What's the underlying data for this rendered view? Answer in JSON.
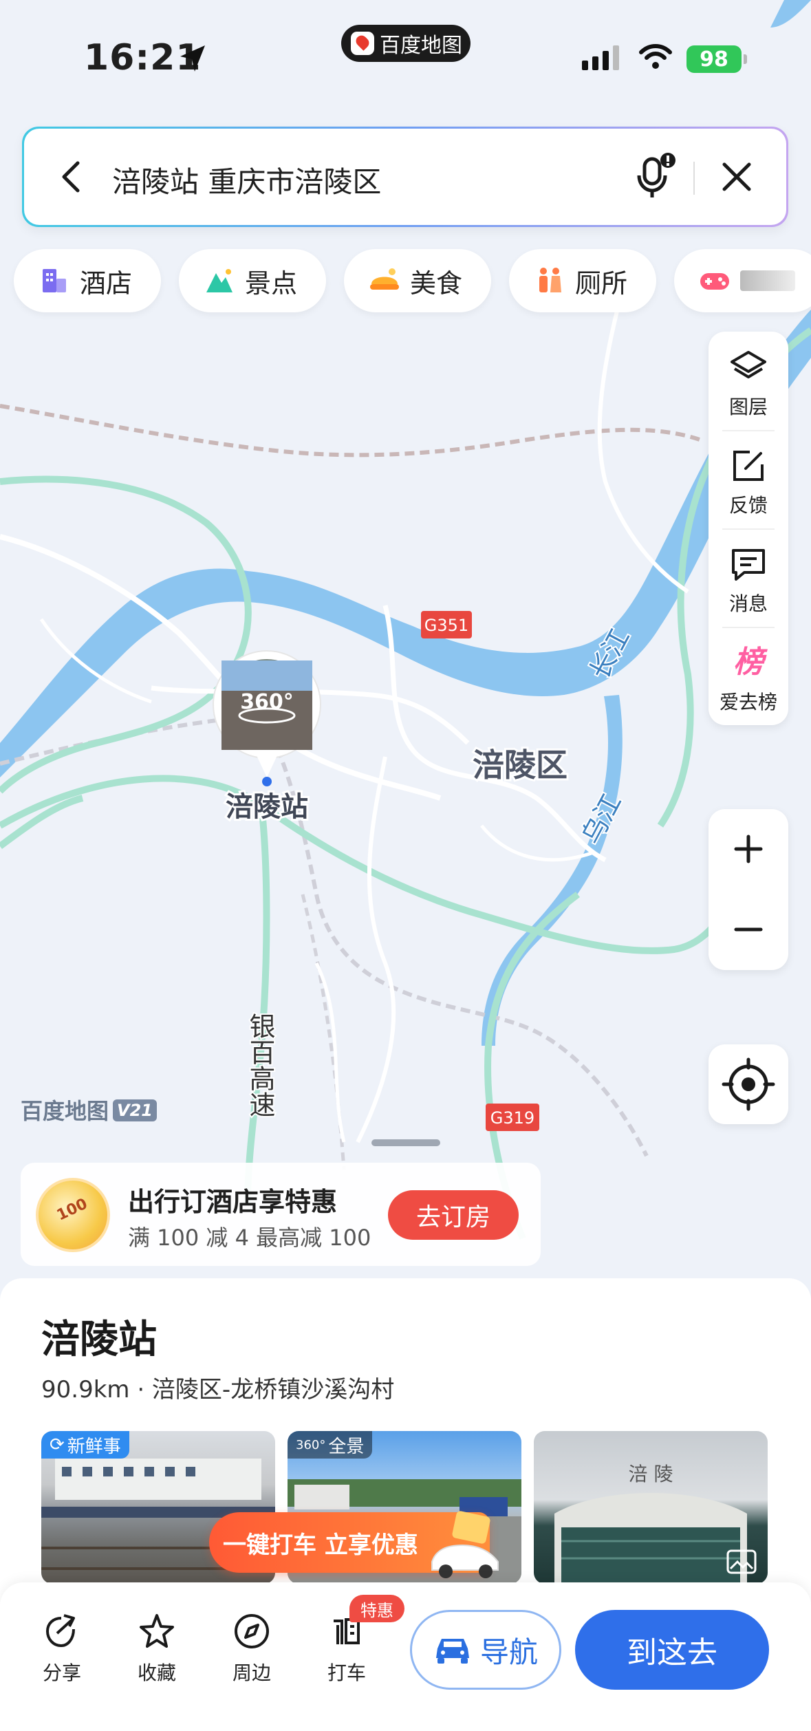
{
  "status_bar": {
    "time": "16:21",
    "app_name": "百度地图",
    "battery": "98"
  },
  "search": {
    "query": "涪陵站 重庆市涪陵区"
  },
  "categories": [
    {
      "label": "酒店",
      "icon": "hotel-icon"
    },
    {
      "label": "景点",
      "icon": "scenic-icon"
    },
    {
      "label": "美食",
      "icon": "food-icon"
    },
    {
      "label": "厕所",
      "icon": "toilet-icon"
    }
  ],
  "side_tools": {
    "layers": "图层",
    "feedback": "反馈",
    "messages": "消息",
    "ranking": "爱去榜",
    "ranking_icon_text": "榜"
  },
  "map": {
    "station_label": "涪陵站",
    "pano_label": "360°",
    "district_label": "涪陵区",
    "river1": "长江",
    "river2": "乌江",
    "road_g351": "G351",
    "road_g319": "G319",
    "highway": "银百高速",
    "brand": "百度地图",
    "brand_version": "V21"
  },
  "promo": {
    "title": "出行订酒店享特惠",
    "subtitle": "满 100 减 4 最高减 100",
    "button": "去订房"
  },
  "place": {
    "name": "涪陵站",
    "meta": "90.9km · 涪陵区-龙桥镇沙溪沟村",
    "photo_tags": [
      "新鲜事",
      "全景"
    ],
    "photo3_sign": "涪 陵"
  },
  "cab_banner": "一键打车 立享优惠",
  "bottom_bar": {
    "share": "分享",
    "favorite": "收藏",
    "nearby": "周边",
    "taxi": "打车",
    "deal_badge": "特惠",
    "navigate": "导航",
    "go_here": "到这去"
  },
  "colors": {
    "accent_blue": "#2f6fea",
    "promo_red": "#ef4c43",
    "river": "#8cc5f0",
    "highway_green": "#9fe0c8"
  }
}
